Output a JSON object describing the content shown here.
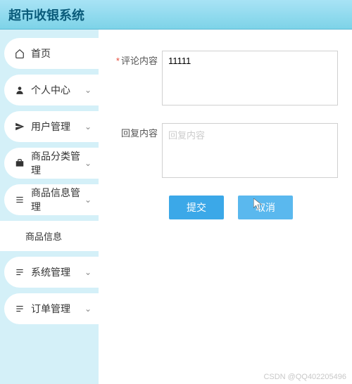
{
  "header": {
    "title": "超市收银系统"
  },
  "sidebar": {
    "items": [
      {
        "icon": "home",
        "label": "首页",
        "expandable": false
      },
      {
        "icon": "user",
        "label": "个人中心",
        "expandable": true
      },
      {
        "icon": "send",
        "label": "用户管理",
        "expandable": true
      },
      {
        "icon": "case",
        "label": "商品分类管理",
        "expandable": true
      },
      {
        "icon": "list",
        "label": "商品信息管理",
        "expandable": true,
        "expanded": true,
        "children": [
          {
            "label": "商品信息"
          }
        ]
      },
      {
        "icon": "list2",
        "label": "系统管理",
        "expandable": true
      },
      {
        "icon": "list2",
        "label": "订单管理",
        "expandable": true
      }
    ]
  },
  "form": {
    "comment_label": "评论内容",
    "comment_value": "11111",
    "reply_label": "回复内容",
    "reply_placeholder": "回复内容",
    "submit_label": "提交",
    "cancel_label": "取消"
  },
  "watermark": "CSDN @QQ402205496"
}
